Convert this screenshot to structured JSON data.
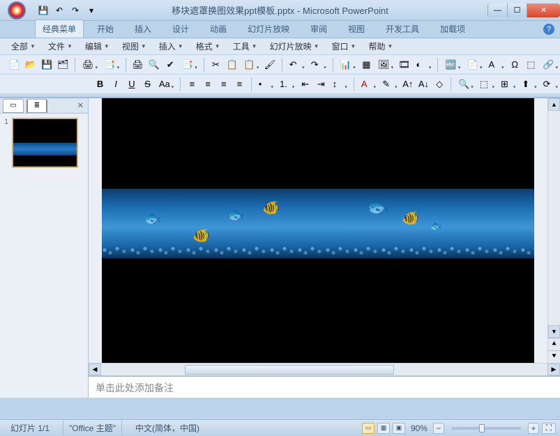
{
  "titlebar": {
    "doc_title": "移块遮罩换图效果ppt模板.pptx - Microsoft PowerPoint"
  },
  "ribbon_tabs": [
    "经典菜单",
    "开始",
    "插入",
    "设计",
    "动画",
    "幻灯片放映",
    "审阅",
    "视图",
    "开发工具",
    "加载项"
  ],
  "active_tab_index": 0,
  "menus": [
    "全部",
    "文件",
    "编辑",
    "视图",
    "插入",
    "格式",
    "工具",
    "幻灯片放映",
    "窗口",
    "帮助"
  ],
  "notes_placeholder": "单击此处添加备注",
  "status": {
    "slide_counter": "幻灯片 1/1",
    "theme": "\"Office 主题\"",
    "language": "中文(简体，中国)",
    "zoom_label": "90%"
  },
  "thumbnail": {
    "number": "1"
  },
  "icons": {
    "save": "💾",
    "undo": "↶",
    "redo": "↷",
    "qat_dd": "▾",
    "new": "📄",
    "open": "📂",
    "save2": "💾",
    "saveall": "🗂",
    "print": "🖨",
    "preview": "🔍",
    "spell": "✔",
    "research": "📑",
    "cut": "✂",
    "copy": "📋",
    "paste": "📋",
    "format_painter": "🖌",
    "chart": "📊",
    "table": "▦",
    "picture": "🖼",
    "clip": "🎞",
    "shapes": "◐",
    "txtbox": "🔤",
    "header": "📄",
    "wordart": "A",
    "symbol": "Ω",
    "object": "⬚",
    "hyperlink": "🔗",
    "bold": "B",
    "italic": "I",
    "underline": "U",
    "strike": "S",
    "superscript": "Aa",
    "clear_format": "◇",
    "align_l": "≡",
    "align_c": "≡",
    "align_r": "≡",
    "justify": "≡",
    "bullets": "•",
    "numbering": "1.",
    "indent_dec": "⇤",
    "indent_inc": "⇥",
    "line_space": "↕",
    "font_color": "A",
    "highlight": "✎",
    "font_grow": "A↑",
    "font_shrink": "A↓",
    "find": "🔍",
    "select": "⬚",
    "group": "⊞",
    "bring_fwd": "⬆",
    "rotate": "⟳"
  }
}
